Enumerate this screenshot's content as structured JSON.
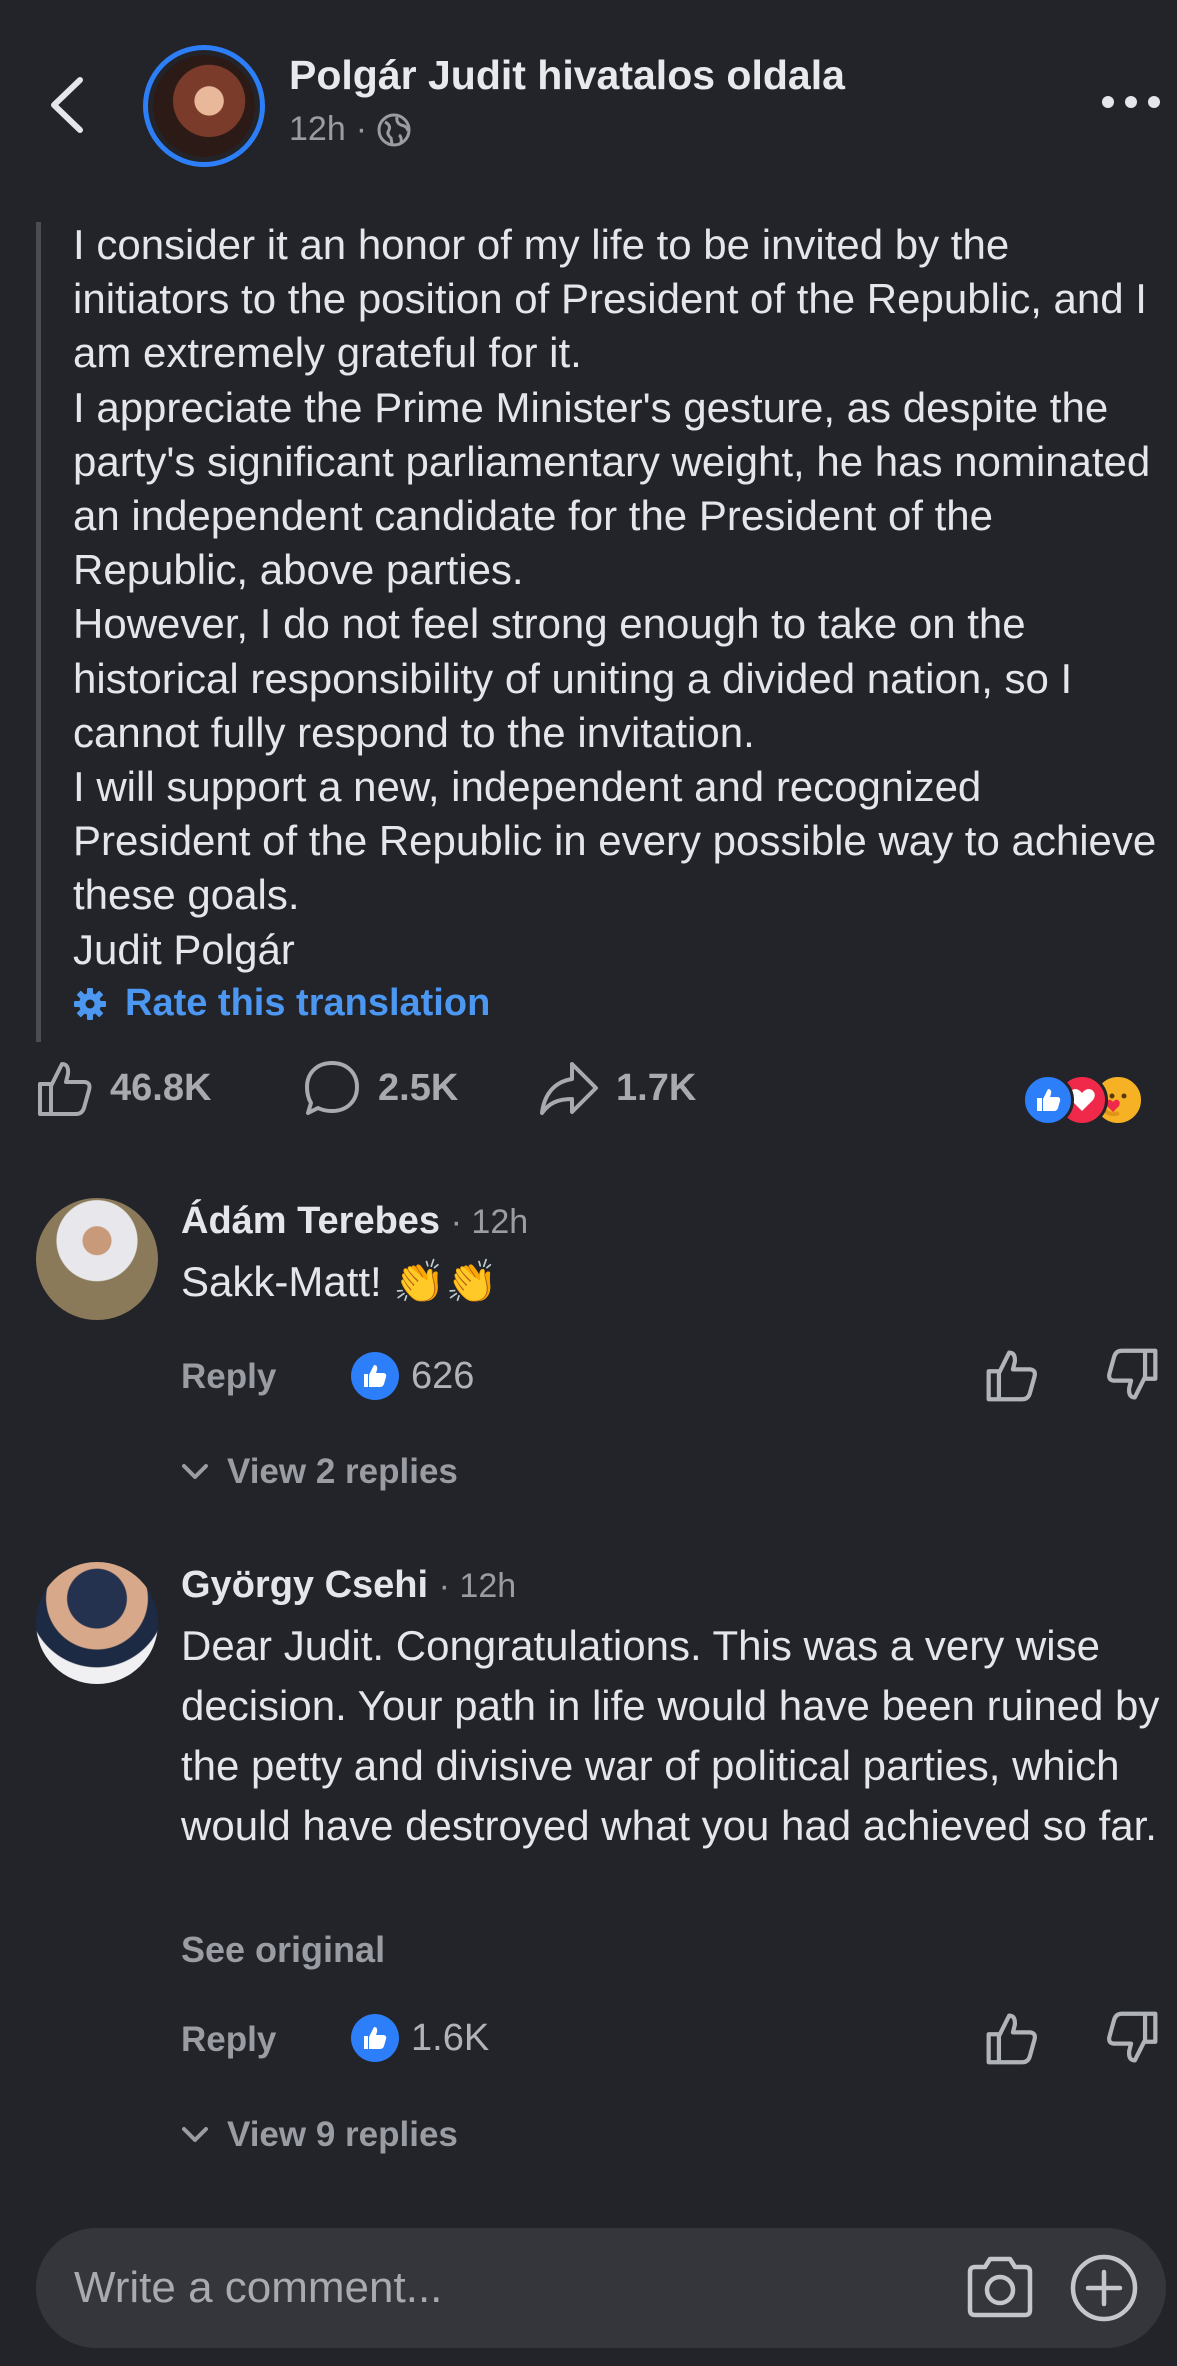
{
  "header": {
    "page_name": "Polgár Judit hivatalos oldala",
    "time": "12h",
    "separator": "·",
    "icons": {
      "back": "chevron-left-icon",
      "audience": "globe-icon",
      "more": "more-horizontal-icon"
    }
  },
  "post": {
    "paragraphs": [
      "I consider it an honor of my life to be invited by the initiators to the position of President of the Republic, and I am extremely grateful for it.",
      "I appreciate the Prime Minister's gesture, as despite the party's significant parliamentary weight, he has nominated an independent candidate for the President of the Republic, above parties.",
      "However, I do not feel strong enough to take on the historical responsibility of uniting a divided nation, so I cannot fully respond to the invitation.",
      "I will support a new, independent and recognized President of the Republic in every possible way to achieve these goals.",
      "Judit Polgár"
    ],
    "rate_translation": "Rate this translation"
  },
  "actions": {
    "likes": "46.8K",
    "comments": "2.5K",
    "shares": "1.7K",
    "reactions": [
      "like",
      "love",
      "care"
    ]
  },
  "comments": [
    {
      "name": "Ádám Terebes",
      "time": "12h",
      "text": "Sakk-Matt! 👏👏",
      "reply_label": "Reply",
      "likes": "626",
      "view_replies": "View 2 replies"
    },
    {
      "name": "György Csehi",
      "time": "12h",
      "text": "Dear Judit. Congratulations. This was a very wise decision. Your path in life would have been ruined by the petty and divisive war of political parties, which would have destroyed what you had achieved so far.",
      "see_original": "See original",
      "reply_label": "Reply",
      "likes": "1.6K",
      "view_replies": "View 9 replies"
    }
  ],
  "composer": {
    "placeholder": "Write a comment..."
  },
  "colors": {
    "background": "#232429",
    "accent_blue": "#2d7ff9",
    "link_blue": "#4b97f2",
    "love_red": "#f0284a",
    "care_yellow": "#f7b125"
  }
}
